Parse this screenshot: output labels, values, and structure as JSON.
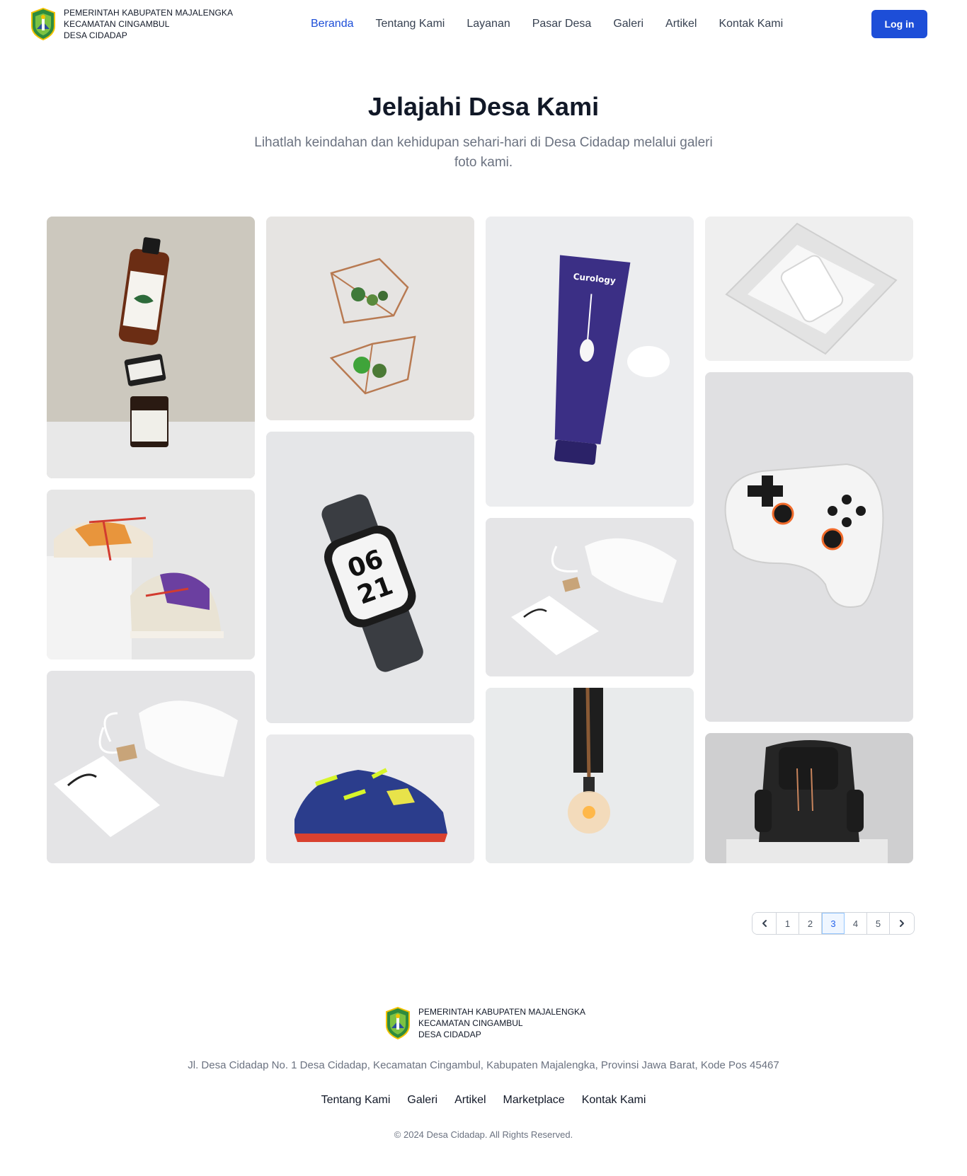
{
  "header": {
    "logo_icon": "majalengka-crest-icon",
    "brand_lines": [
      "PEMERINTAH KABUPATEN MAJALENGKA",
      "KECAMATAN CINGAMBUL",
      "DESA CIDADAP"
    ],
    "nav": [
      "Beranda",
      "Tentang Kami",
      "Layanan",
      "Pasar Desa",
      "Galeri",
      "Artikel",
      "Kontak Kami"
    ],
    "active_nav": "Beranda",
    "login_label": "Log in"
  },
  "hero": {
    "title": "Jelajahi Desa Kami",
    "subtitle": "Lihatlah keindahan dan kehidupan sehari-hari di Desa Cidadap melalui galeri foto kami."
  },
  "gallery": {
    "photos": [
      {
        "subject": "stacked-skincare-bottles"
      },
      {
        "subject": "geometric-wall-planters"
      },
      {
        "subject": "purple-cleanser-tube"
      },
      {
        "subject": "bottle-in-glass-box"
      },
      {
        "subject": "two-sneakers"
      },
      {
        "subject": "smartwatch"
      },
      {
        "subject": "pouch-and-bag"
      },
      {
        "subject": "game-controller"
      },
      {
        "subject": "pouch-and-bag-large"
      },
      {
        "subject": "blue-football-shoe"
      },
      {
        "subject": "hanging-bulb"
      },
      {
        "subject": "black-leather-backpack"
      }
    ]
  },
  "pagination": {
    "prev_icon": "chevron-left-icon",
    "pages": [
      "1",
      "2",
      "3",
      "4",
      "5"
    ],
    "current": "3",
    "next_icon": "chevron-right-icon"
  },
  "footer": {
    "brand_lines": [
      "PEMERINTAH KABUPATEN MAJALENGKA",
      "KECAMATAN CINGAMBUL",
      "DESA CIDADAP"
    ],
    "address": "Jl. Desa Cidadap No. 1 Desa Cidadap, Kecamatan Cingambul, Kabupaten Majalengka, Provinsi Jawa Barat, Kode Pos 45467",
    "links": [
      "Tentang Kami",
      "Galeri",
      "Artikel",
      "Marketplace",
      "Kontak Kami"
    ],
    "copyright": "© 2024 Desa Cidadap. All Rights Reserved."
  },
  "colors": {
    "accent": "#1d4ed8",
    "text": "#111827",
    "muted": "#6b7280"
  }
}
